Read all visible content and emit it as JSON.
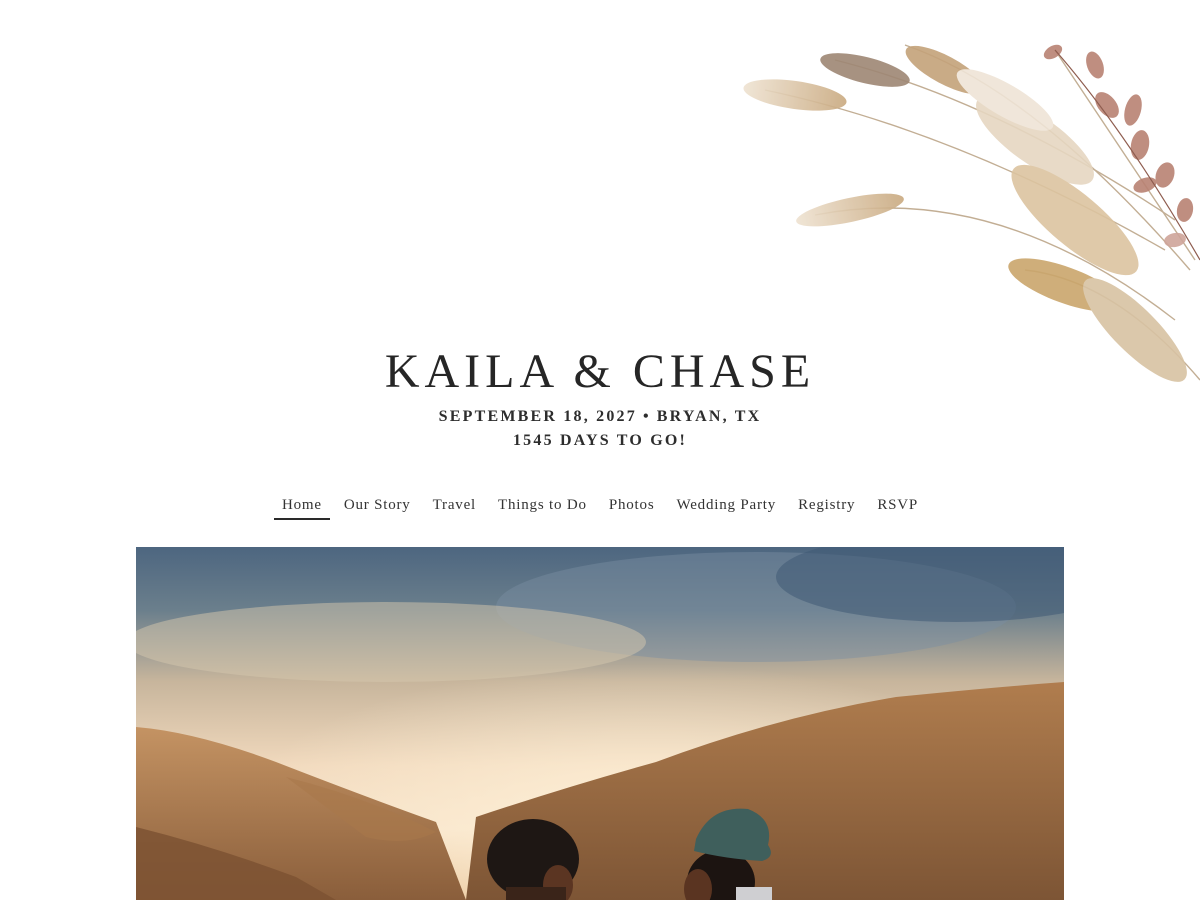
{
  "header": {
    "couple": "KAILA & CHASE",
    "date": "SEPTEMBER 18, 2027",
    "separator": "•",
    "location": "BRYAN, TX",
    "countdown": "1545 DAYS TO GO!"
  },
  "nav": {
    "active_index": 0,
    "items": [
      {
        "label": "Home"
      },
      {
        "label": "Our Story"
      },
      {
        "label": "Travel"
      },
      {
        "label": "Things to Do"
      },
      {
        "label": "Photos"
      },
      {
        "label": "Wedding Party"
      },
      {
        "label": "Registry"
      },
      {
        "label": "RSVP"
      }
    ]
  },
  "theme": {
    "text": "#2a2a2a",
    "sky_top": "#4f6a86",
    "sky_glow": "#f3d9b8",
    "hills": "#b98a5a",
    "floral_wheat": "#d9c2a1",
    "floral_leaf": "#b07a66"
  },
  "hero": {
    "icon": "couple-photo"
  }
}
